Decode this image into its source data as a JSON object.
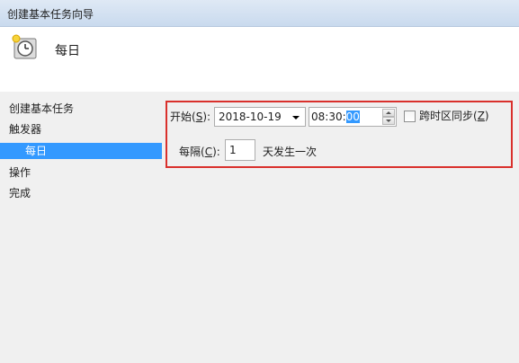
{
  "window": {
    "title": "创建基本任务向导"
  },
  "header": {
    "icon": "clock-icon",
    "title": "每日"
  },
  "sidebar": {
    "items": [
      {
        "label": "创建基本任务"
      },
      {
        "label": "触发器"
      },
      {
        "label": "每日",
        "selected": true
      },
      {
        "label": "操作"
      },
      {
        "label": "完成"
      }
    ]
  },
  "trigger": {
    "start_label": "开始(",
    "start_key": "S",
    "start_label_end": "):",
    "date_value": "2018-10-19",
    "time_value_prefix": "08:30:",
    "time_value_selected": "00",
    "sync_label": "跨时区同步(",
    "sync_key": "Z",
    "sync_label_end": ")",
    "sync_checked": false,
    "interval_label": "每隔(",
    "interval_key": "C",
    "interval_label_end": "):",
    "interval_value": "1",
    "interval_suffix": "天发生一次"
  },
  "colors": {
    "selection": "#3399ff",
    "highlight_border": "#d9302c"
  }
}
